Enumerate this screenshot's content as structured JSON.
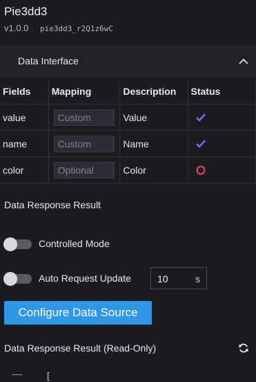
{
  "app": {
    "title": "Pie3dd3",
    "version": "v1.0.0",
    "version_id": "pie3dd3_r2Q1z6wC"
  },
  "data_interface": {
    "title": "Data Interface",
    "columns": [
      "Fields",
      "Mapping",
      "Description",
      "Status"
    ],
    "rows": [
      {
        "field": "value",
        "mapping_placeholder": "Custom",
        "description": "Value",
        "status": "check-icon"
      },
      {
        "field": "name",
        "mapping_placeholder": "Custom",
        "description": "Name",
        "status": "check-icon"
      },
      {
        "field": "color",
        "mapping_placeholder": "Optional",
        "description": "Color",
        "status": "circle-icon"
      }
    ]
  },
  "response": {
    "title": "Data Response Result",
    "controlled_mode_label": "Controlled Mode",
    "auto_update_label": "Auto Request Update",
    "interval_value": "10",
    "interval_unit": "s",
    "configure_button": "Configure Data Source",
    "readonly_title": "Data Response Result (Read-Only)",
    "code_start": "["
  },
  "colors": {
    "background": "#1b1c21",
    "accent": "#2f97e8",
    "check": "#8f6cf0",
    "optional_circle": "#e8496a"
  }
}
